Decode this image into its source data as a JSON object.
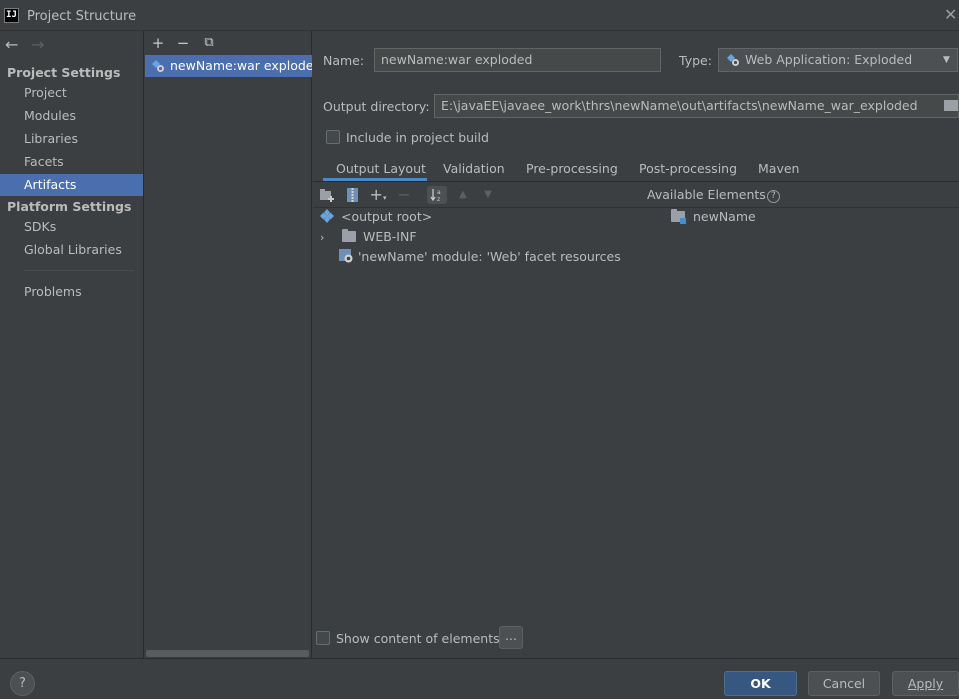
{
  "window": {
    "title": "Project Structure",
    "logo_text": "IJ",
    "close_glyph": "✕"
  },
  "sidebar": {
    "back_glyph": "←",
    "forward_glyph": "→",
    "project_settings_label": "Project Settings",
    "project_items": [
      "Project",
      "Modules",
      "Libraries",
      "Facets",
      "Artifacts"
    ],
    "selected_item": "Artifacts",
    "platform_settings_label": "Platform Settings",
    "platform_items": [
      "SDKs",
      "Global Libraries"
    ],
    "problems_label": "Problems"
  },
  "artifacts": {
    "toolbar": {
      "add": "+",
      "remove": "−",
      "copy": "⧉"
    },
    "items": [
      "newName:war exploded"
    ]
  },
  "editor": {
    "name_label": "Name:",
    "name_value": "newName:war exploded",
    "type_label": "Type:",
    "type_value": "Web Application: Exploded",
    "output_dir_label": "Output directory:",
    "output_dir_value": "E:\\javaEE\\javaee_work\\thrs\\newName\\out\\artifacts\\newName_war_exploded",
    "include_build_label": "Include in project build",
    "include_build_checked": false,
    "tabs": [
      "Output Layout",
      "Validation",
      "Pre-processing",
      "Post-processing",
      "Maven"
    ],
    "active_tab": "Output Layout",
    "available_elements_label": "Available Elements",
    "help_glyph": "?",
    "tree": [
      {
        "label": "<output root>",
        "icon": "artifact-icon"
      },
      {
        "label": "WEB-INF",
        "icon": "folder-icon",
        "expandable": true
      },
      {
        "label": "'newName' module: 'Web' facet resources",
        "icon": "web-facet-icon"
      }
    ],
    "available_tree": [
      {
        "label": "newName",
        "icon": "module-folder-icon"
      }
    ],
    "show_content_label": "Show content of elements",
    "show_content_checked": false,
    "more_button_label": "..."
  },
  "footer": {
    "help_label": "?",
    "ok_label": "OK",
    "cancel_label": "Cancel",
    "apply_label": "Apply"
  },
  "colors": {
    "background": "#3c3f41",
    "selection": "#4b6eaf",
    "ok_button": "#365880",
    "tab_underline": "#4a88c7"
  }
}
